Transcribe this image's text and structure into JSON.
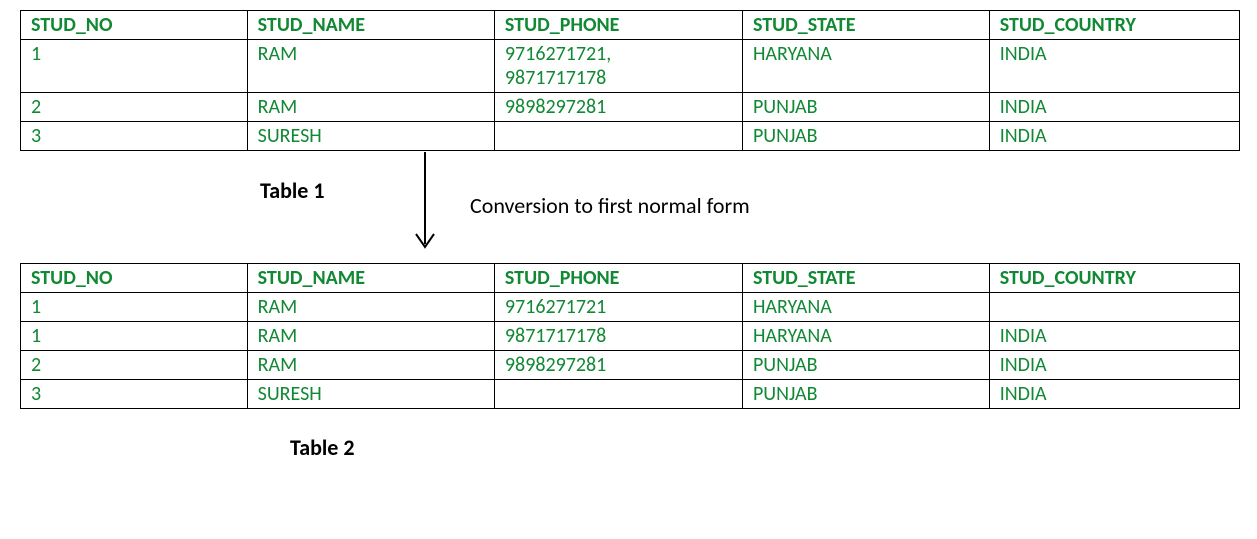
{
  "table1": {
    "headers": [
      "STUD_NO",
      "STUD_NAME",
      "STUD_PHONE",
      "STUD_STATE",
      "STUD_COUNTRY"
    ],
    "rows": [
      {
        "no": "1",
        "name": "RAM",
        "phone_a": "9716271721,",
        "phone_b": "9871717178",
        "state": "HARYANA",
        "country": "INDIA"
      },
      {
        "no": "2",
        "name": "RAM",
        "phone_a": "9898297281",
        "phone_b": "",
        "state": "PUNJAB",
        "country": "INDIA"
      },
      {
        "no": "3",
        "name": "SURESH",
        "phone_a": "",
        "phone_b": "",
        "state": "PUNJAB",
        "country": "INDIA"
      }
    ],
    "caption": "Table 1"
  },
  "arrow_label": "Conversion to first normal form",
  "table2": {
    "headers": [
      "STUD_NO",
      "STUD_NAME",
      "STUD_PHONE",
      "STUD_STATE",
      "STUD_COUNTRY"
    ],
    "rows": [
      {
        "no": "1",
        "name": "RAM",
        "phone": "9716271721",
        "state": "HARYANA",
        "country": ""
      },
      {
        "no": "1",
        "name": "RAM",
        "phone": "9871717178",
        "state": "HARYANA",
        "country": "INDIA"
      },
      {
        "no": "2",
        "name": "RAM",
        "phone": "9898297281",
        "state": "PUNJAB",
        "country": "INDIA"
      },
      {
        "no": "3",
        "name": "SURESH",
        "phone": "",
        "state": "PUNJAB",
        "country": "INDIA"
      }
    ],
    "caption": "Table 2"
  }
}
